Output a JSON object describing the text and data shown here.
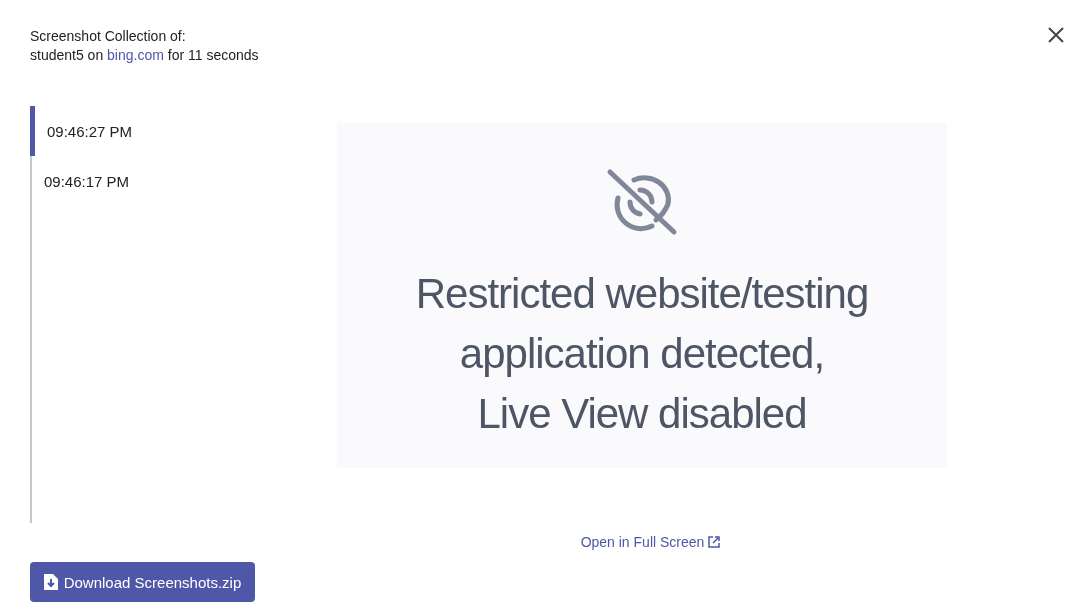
{
  "header": {
    "title": "Screenshot Collection of:",
    "subtitle": {
      "before": "student5 on",
      "link": "bing.com",
      "after": "for 11 seconds"
    }
  },
  "timeline": [
    {
      "time": "09:46:27 PM",
      "selected": true
    },
    {
      "time": "09:46:17 PM",
      "selected": false
    }
  ],
  "preview": {
    "message_lines": [
      "Restricted website/testing",
      "application detected,",
      "Live View disabled"
    ]
  },
  "open_link": "Open in Full Screen",
  "download_button": "Download Screenshots.zip"
}
